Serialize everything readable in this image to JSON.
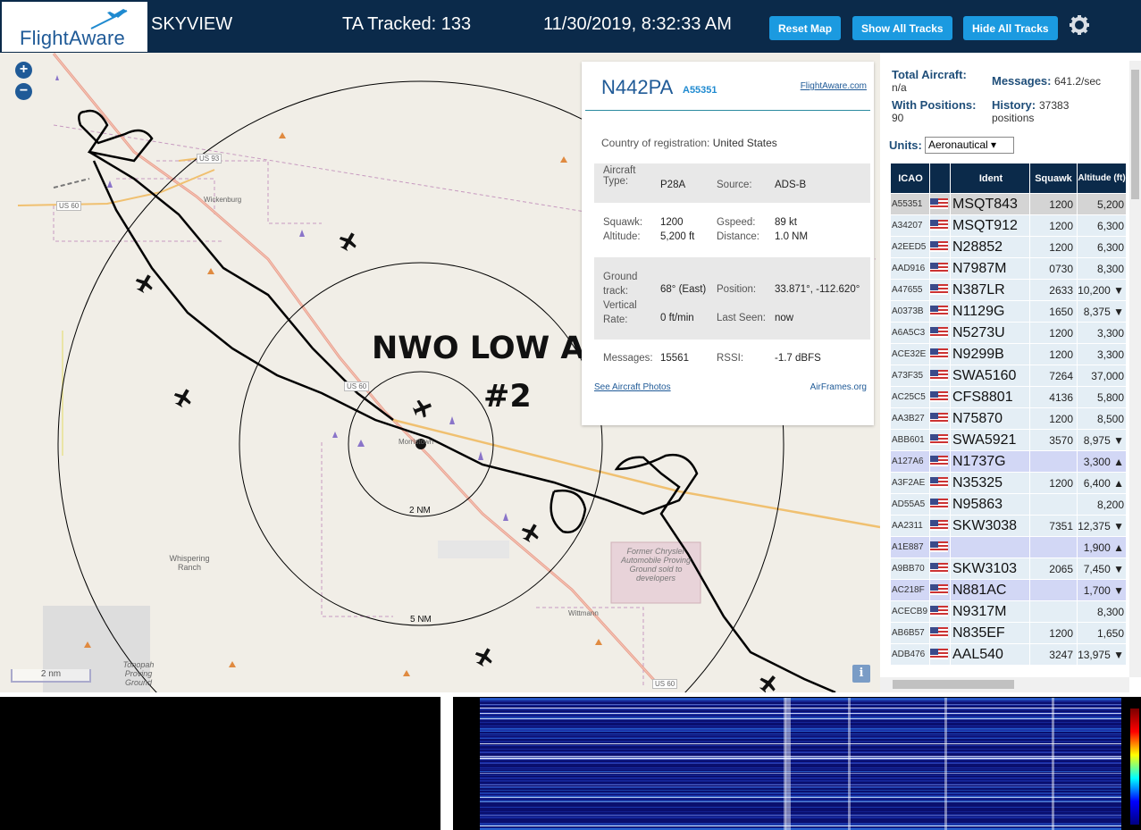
{
  "header": {
    "logo_text": "FlightAware",
    "app_name": "SKYVIEW",
    "tracked": "TA Tracked: 133",
    "datetime": "11/30/2019, 8:32:33 AM",
    "reset_map": "Reset Map",
    "show_all": "Show All Tracks",
    "hide_all": "Hide All Tracks",
    "settings_icon": "gear-icon"
  },
  "map": {
    "zoom_in": "+",
    "zoom_out": "−",
    "overlay_title": "NWO LOW ALT",
    "overlay_sub": "#2",
    "ring_2nm": "2 NM",
    "ring_5nm": "5 NM",
    "scale": "2 nm",
    "info": "i",
    "labels": {
      "wickenburg": "Wickenburg",
      "morristown": "Morristown",
      "wittmann": "Wittmann",
      "whispering": "Whispering Ranch",
      "proving": "Former Chrysler Automobile Proving Ground sold to developers",
      "tonopah": "Tonopah Proving Ground",
      "us60a": "US 60",
      "us60b": "US 60",
      "us60c": "US 60",
      "us93": "US 93"
    }
  },
  "popup": {
    "registration": "N442PA",
    "hex": "A55351",
    "fa_link": "FlightAware.com",
    "country_label": "Country of registration:",
    "country_value": "United States",
    "aircraft_type_label": "Aircraft Type:",
    "aircraft_type_value": "P28A",
    "source_label": "Source:",
    "source_value": "ADS-B",
    "squawk_label": "Squawk:",
    "squawk_value": "1200",
    "altitude_label": "Altitude:",
    "altitude_value": "5,200 ft",
    "gspeed_label": "Gspeed:",
    "gspeed_value": "89 kt",
    "distance_label": "Distance:",
    "distance_value": "1.0 NM",
    "ground_track_label": "Ground track:",
    "ground_track_value": "68° (East)",
    "position_label": "Position:",
    "position_value": "33.871°, -112.620°",
    "vrate_label": "Vertical Rate:",
    "vrate_value": "0 ft/min",
    "last_seen_label": "Last Seen:",
    "last_seen_value": "now",
    "messages_label": "Messages:",
    "messages_value": "15561",
    "rssi_label": "RSSI:",
    "rssi_value": "-1.7 dBFS",
    "photos_link": "See Aircraft Photos",
    "airframes_link": "AirFrames.org"
  },
  "sidebar": {
    "total_label": "Total Aircraft:",
    "total_value": "n/a",
    "messages_label": "Messages:",
    "messages_value": "641.2/sec",
    "withpos_label": "With Positions:",
    "withpos_value": "90",
    "history_label": "History:",
    "history_value": "37383",
    "history_unit": "positions",
    "units_label": "Units:",
    "units_value": "Aeronautical ▾",
    "columns": [
      "ICAO",
      "Ident",
      "Squawk",
      "Altitude (ft)"
    ],
    "rows": [
      {
        "icao": "A55351",
        "ident": "MSQT843",
        "squawk": "1200",
        "alt": "5,200",
        "state": "sel"
      },
      {
        "icao": "A34207",
        "ident": "MSQT912",
        "squawk": "1200",
        "alt": "6,300",
        "state": ""
      },
      {
        "icao": "A2EED5",
        "ident": "N28852",
        "squawk": "1200",
        "alt": "6,300",
        "state": ""
      },
      {
        "icao": "AAD916",
        "ident": "N7987M",
        "squawk": "0730",
        "alt": "8,300",
        "state": ""
      },
      {
        "icao": "A47655",
        "ident": "N387LR",
        "squawk": "2633",
        "alt": "10,200 ▼",
        "state": ""
      },
      {
        "icao": "A0373B",
        "ident": "N1129G",
        "squawk": "1650",
        "alt": "8,375 ▼",
        "state": ""
      },
      {
        "icao": "A6A5C3",
        "ident": "N5273U",
        "squawk": "1200",
        "alt": "3,300",
        "state": ""
      },
      {
        "icao": "ACE32E",
        "ident": "N9299B",
        "squawk": "1200",
        "alt": "3,300",
        "state": ""
      },
      {
        "icao": "A73F35",
        "ident": "SWA5160",
        "squawk": "7264",
        "alt": "37,000",
        "state": ""
      },
      {
        "icao": "AC25C5",
        "ident": "CFS8801",
        "squawk": "4136",
        "alt": "5,800",
        "state": ""
      },
      {
        "icao": "AA3B27",
        "ident": "N75870",
        "squawk": "1200",
        "alt": "8,500",
        "state": ""
      },
      {
        "icao": "ABB601",
        "ident": "SWA5921",
        "squawk": "3570",
        "alt": "8,975 ▼",
        "state": ""
      },
      {
        "icao": "A127A6",
        "ident": "N1737G",
        "squawk": "",
        "alt": "3,300 ▲",
        "state": "nopos"
      },
      {
        "icao": "A3F2AE",
        "ident": "N35325",
        "squawk": "1200",
        "alt": "6,400 ▲",
        "state": ""
      },
      {
        "icao": "AD55A5",
        "ident": "N95863",
        "squawk": "",
        "alt": "8,200",
        "state": ""
      },
      {
        "icao": "AA2311",
        "ident": "SKW3038",
        "squawk": "7351",
        "alt": "12,375 ▼",
        "state": ""
      },
      {
        "icao": "A1E887",
        "ident": "",
        "squawk": "",
        "alt": "1,900 ▲",
        "state": "nopos"
      },
      {
        "icao": "A9BB70",
        "ident": "SKW3103",
        "squawk": "2065",
        "alt": "7,450 ▼",
        "state": ""
      },
      {
        "icao": "AC218F",
        "ident": "N881AC",
        "squawk": "",
        "alt": "1,700 ▼",
        "state": "nopos"
      },
      {
        "icao": "ACECB9",
        "ident": "N9317M",
        "squawk": "",
        "alt": "8,300",
        "state": ""
      },
      {
        "icao": "AB6B57",
        "ident": "N835EF",
        "squawk": "1200",
        "alt": "1,650",
        "state": ""
      },
      {
        "icao": "ADB476",
        "ident": "AAL540",
        "squawk": "3247",
        "alt": "13,975 ▼",
        "state": ""
      }
    ]
  }
}
